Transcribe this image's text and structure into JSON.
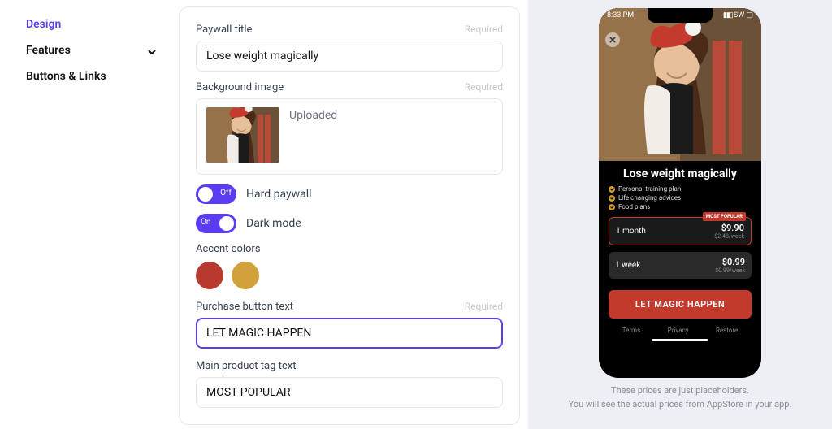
{
  "sidebar": {
    "items": [
      {
        "label": "Design",
        "active": true
      },
      {
        "label": "Features",
        "expandable": true
      },
      {
        "label": "Buttons & Links"
      }
    ]
  },
  "form": {
    "paywall_title": {
      "label": "Paywall title",
      "required_text": "Required",
      "value": "Lose weight magically"
    },
    "background_image": {
      "label": "Background image",
      "required_text": "Required",
      "status": "Uploaded"
    },
    "hard_paywall": {
      "state_text": "Off",
      "label": "Hard paywall"
    },
    "dark_mode": {
      "state_text": "On",
      "label": "Dark mode"
    },
    "accent_colors": {
      "label": "Accent colors",
      "colors": [
        "#B8392E",
        "#D1A23C"
      ]
    },
    "purchase_button": {
      "label": "Purchase button text",
      "required_text": "Required",
      "value": "LET MAGIC HAPPEN"
    },
    "main_tag": {
      "label": "Main product tag text",
      "value": "MOST POPULAR"
    }
  },
  "preview": {
    "status_time": "8:33 PM",
    "status_right": "SW",
    "title": "Lose weight magically",
    "features": [
      "Personal training plan",
      "Life changing advices",
      "Food plans"
    ],
    "plans": [
      {
        "name": "1 month",
        "price": "$9.90",
        "sub": "$2.48/week",
        "selected": true,
        "tag": "MOST POPULAR"
      },
      {
        "name": "1 week",
        "price": "$0.99",
        "sub": "$0.99/week",
        "selected": false
      }
    ],
    "cta": "LET MAGIC HAPPEN",
    "footer_links": [
      "Terms",
      "Privacy",
      "Restore"
    ]
  },
  "disclaimer": {
    "line1": "These prices are just placeholders.",
    "line2": "You will see the actual prices from AppStore in your app."
  }
}
